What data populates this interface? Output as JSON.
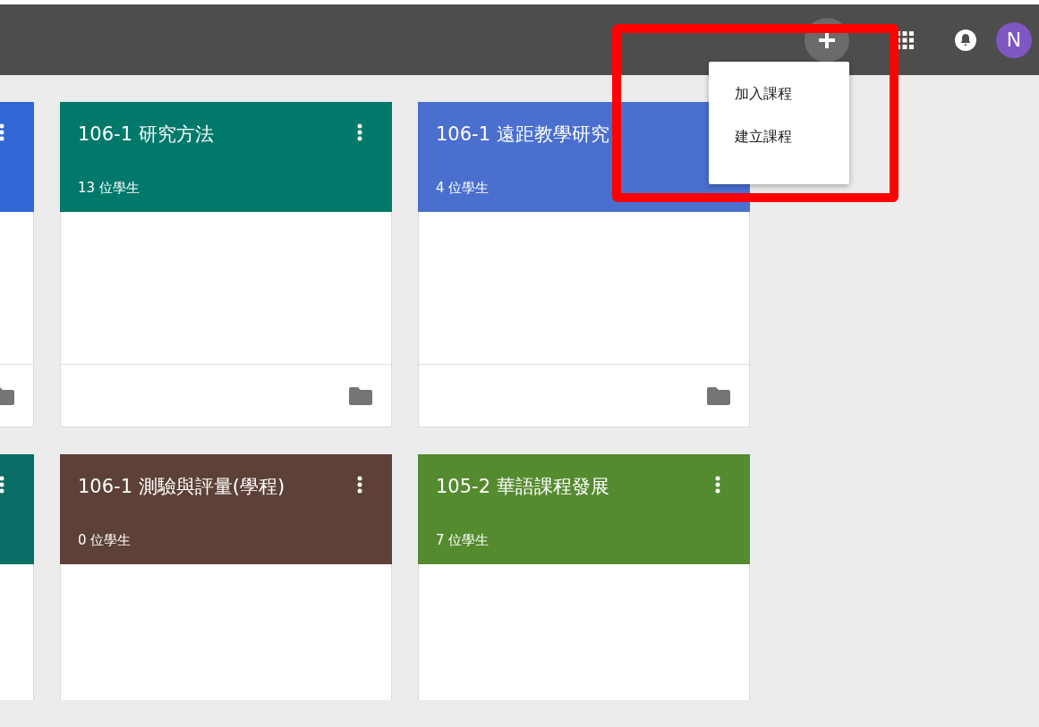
{
  "top_bar": {
    "avatar_letter": "N"
  },
  "add_menu": {
    "items": [
      {
        "label": "加入課程"
      },
      {
        "label": "建立課程"
      }
    ]
  },
  "course_rows": [
    {
      "cards": [
        {
          "kind": "clipped",
          "color": "#3367d6"
        },
        {
          "kind": "full",
          "title": "106-1 研究方法",
          "students": "13 位學生",
          "color": "#00796b"
        },
        {
          "kind": "full",
          "title": "106-1 遠距教學研究",
          "students": "4 位學生",
          "color": "#4a6fcf"
        }
      ]
    },
    {
      "cards": [
        {
          "kind": "clipped",
          "color": "#0b6e66"
        },
        {
          "kind": "full",
          "title": "106-1 測驗與評量(學程)",
          "students": "0 位學生",
          "color": "#5d4037"
        },
        {
          "kind": "full",
          "title": "105-2 華語課程發展",
          "students": "7 位學生",
          "color": "#558b2f"
        }
      ]
    }
  ]
}
